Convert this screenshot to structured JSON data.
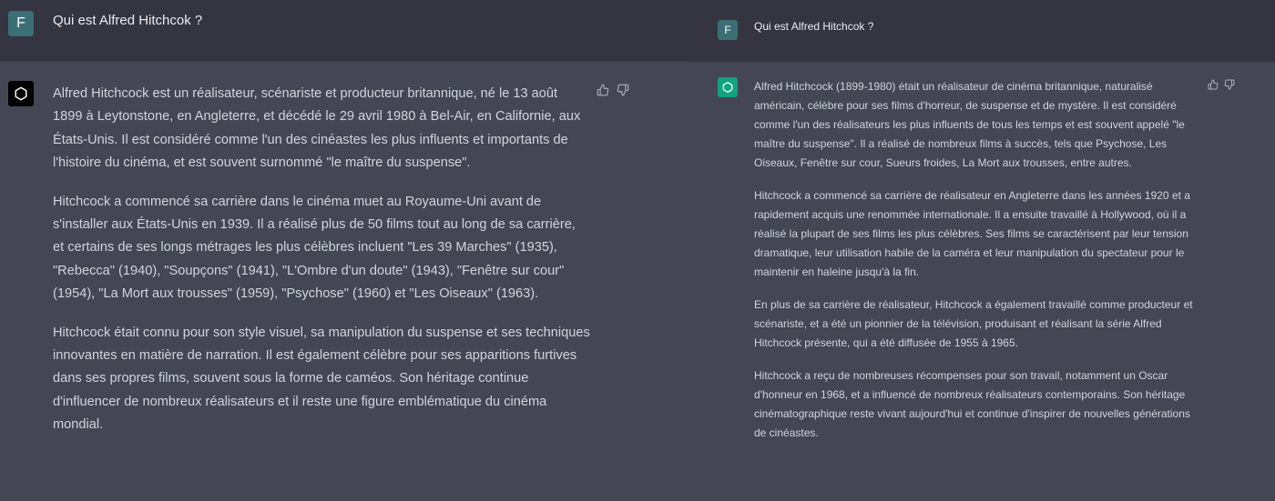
{
  "left_panel": {
    "user": {
      "avatar_letter": "F",
      "question": "Qui est Alfred Hitchcok ?"
    },
    "assistant": {
      "avatar_icon": "openai-logo-icon",
      "avatar_bg": "#000000",
      "paragraphs": [
        "Alfred Hitchcock est un réalisateur, scénariste et producteur britannique, né le 13 août 1899 à Leytonstone, en Angleterre, et décédé le 29 avril 1980 à Bel-Air, en Californie, aux États-Unis. Il est considéré comme l'un des cinéastes les plus influents et importants de l'histoire du cinéma, et est souvent surnommé \"le maître du suspense\".",
        "Hitchcock a commencé sa carrière dans le cinéma muet au Royaume-Uni avant de s'installer aux États-Unis en 1939. Il a réalisé plus de 50 films tout au long de sa carrière, et certains de ses longs métrages les plus célèbres incluent \"Les 39 Marches\" (1935), \"Rebecca\" (1940), \"Soupçons\" (1941), \"L'Ombre d'un doute\" (1943), \"Fenêtre sur cour\" (1954), \"La Mort aux trousses\" (1959), \"Psychose\" (1960) et \"Les Oiseaux\" (1963).",
        "Hitchcock était connu pour son style visuel, sa manipulation du suspense et ses techniques innovantes en matière de narration. Il est également célèbre pour ses apparitions furtives dans ses propres films, souvent sous la forme de caméos. Son héritage continue d'influencer de nombreux réalisateurs et il reste une figure emblématique du cinéma mondial."
      ],
      "feedback_icons": [
        "thumbs-up-icon",
        "thumbs-down-icon"
      ]
    }
  },
  "right_panel": {
    "user": {
      "avatar_letter": "F",
      "question": "Qui est Alfred Hitchcok ?"
    },
    "assistant": {
      "avatar_icon": "openai-logo-icon",
      "avatar_bg": "#10a37f",
      "paragraphs": [
        "Alfred Hitchcock (1899-1980) était un réalisateur de cinéma britannique, naturalisé américain, célèbre pour ses films d'horreur, de suspense et de mystère. Il est considéré comme l'un des réalisateurs les plus influents de tous les temps et est souvent appelé \"le maître du suspense\". Il a réalisé de nombreux films à succès, tels que Psychose, Les Oiseaux, Fenêtre sur cour, Sueurs froides, La Mort aux trousses, entre autres.",
        "Hitchcock a commencé sa carrière de réalisateur en Angleterre dans les années 1920 et a rapidement acquis une renommée internationale. Il a ensuite travaillé à Hollywood, où il a réalisé la plupart de ses films les plus célèbres. Ses films se caractérisent par leur tension dramatique, leur utilisation habile de la caméra et leur manipulation du spectateur pour le maintenir en haleine jusqu'à la fin.",
        "En plus de sa carrière de réalisateur, Hitchcock a également travaillé comme producteur et scénariste, et a été un pionnier de la télévision, produisant et réalisant la série Alfred Hitchcock présente, qui a été diffusée de 1955 à 1965.",
        "Hitchcock a reçu de nombreuses récompenses pour son travail, notamment un Oscar d'honneur en 1968, et a influencé de nombreux réalisateurs contemporains. Son héritage cinématographique reste vivant aujourd'hui et continue d'inspirer de nouvelles générations de cinéastes."
      ],
      "feedback_icons": [
        "thumbs-up-icon",
        "thumbs-down-icon"
      ]
    }
  },
  "colors": {
    "user_bg": "#343541",
    "assistant_bg": "#444654",
    "user_avatar": "#3b6e75",
    "text": "#d1d5db"
  }
}
